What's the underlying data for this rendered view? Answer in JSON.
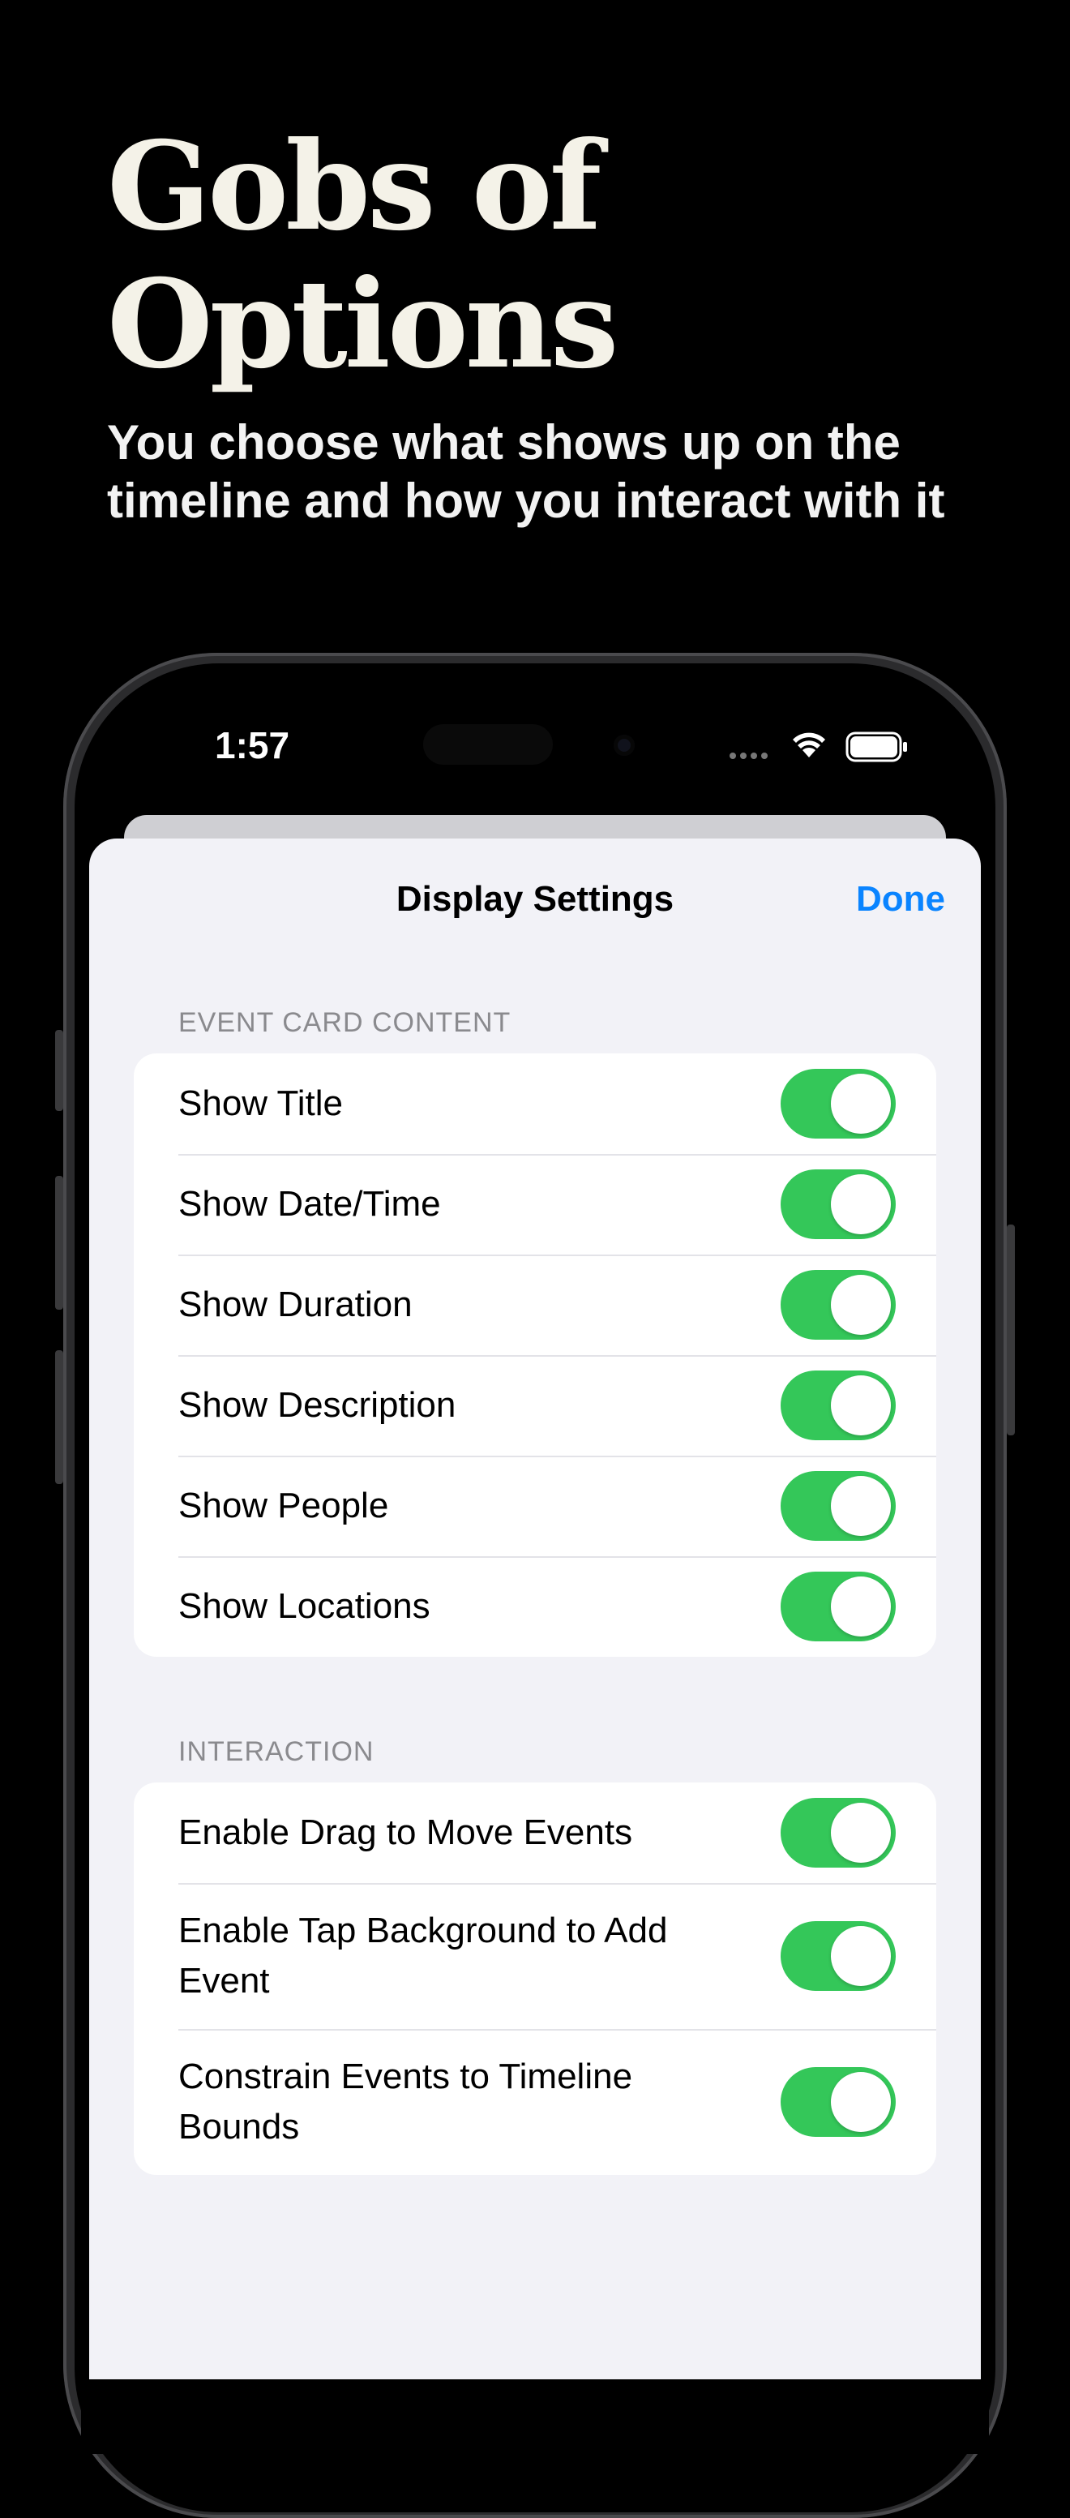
{
  "hero": {
    "title_line1": "Gobs of",
    "title_line2": "Options",
    "subtitle_line1": "You choose what shows up on the",
    "subtitle_line2": "timeline and how you interact with it"
  },
  "status_bar": {
    "time": "1:57",
    "icons": [
      "signal-dots-icon",
      "wifi-icon",
      "battery-icon"
    ]
  },
  "sheet": {
    "title": "Display Settings",
    "done_label": "Done"
  },
  "sections": [
    {
      "header": "EVENT CARD CONTENT",
      "rows": [
        {
          "label": "Show Title",
          "on": true
        },
        {
          "label": "Show Date/Time",
          "on": true
        },
        {
          "label": "Show Duration",
          "on": true
        },
        {
          "label": "Show Description",
          "on": true
        },
        {
          "label": "Show People",
          "on": true
        },
        {
          "label": "Show Locations",
          "on": true
        }
      ]
    },
    {
      "header": "INTERACTION",
      "rows": [
        {
          "label": "Enable Drag to Move Events",
          "on": true
        },
        {
          "label": "Enable Tap Background to Add Event",
          "on": true
        },
        {
          "label": "Constrain Events to Timeline Bounds",
          "on": true
        }
      ]
    }
  ],
  "colors": {
    "accent": "#0a84ff",
    "toggle_on": "#34c759",
    "sheet_bg": "#f2f2f7",
    "page_bg": "#000000"
  }
}
